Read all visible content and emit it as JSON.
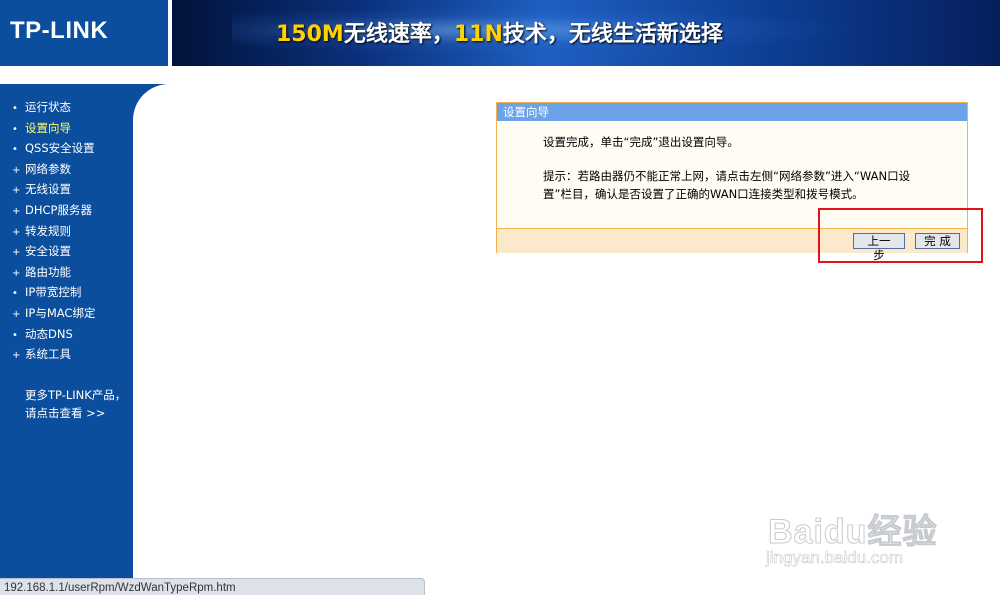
{
  "header": {
    "logo": "TP-LINK",
    "banner_hi1": "150M",
    "banner_mid1": "无线速率，",
    "banner_hi2": "11N",
    "banner_mid2": "技术，无线生活新选择"
  },
  "sidebar": {
    "items": [
      {
        "marker": "•",
        "label": "运行状态"
      },
      {
        "marker": "•",
        "label": "设置向导"
      },
      {
        "marker": "•",
        "label": "QSS安全设置"
      },
      {
        "marker": "+",
        "label": "网络参数"
      },
      {
        "marker": "+",
        "label": "无线设置"
      },
      {
        "marker": "+",
        "label": "DHCP服务器"
      },
      {
        "marker": "+",
        "label": "转发规则"
      },
      {
        "marker": "+",
        "label": "安全设置"
      },
      {
        "marker": "+",
        "label": "路由功能"
      },
      {
        "marker": "•",
        "label": "IP带宽控制"
      },
      {
        "marker": "+",
        "label": "IP与MAC绑定"
      },
      {
        "marker": "•",
        "label": "动态DNS"
      },
      {
        "marker": "+",
        "label": "系统工具"
      }
    ],
    "more_line1": "更多TP-LINK产品，",
    "more_line2": "请点击查看 >>"
  },
  "wizard": {
    "title": "设置向导",
    "message": "设置完成，单击“完成”退出设置向导。",
    "tip": "提示：若路由器仍不能正常上网，请点击左侧“网络参数”进入“WAN口设置”栏目，确认是否设置了正确的WAN口连接类型和拨号模式。",
    "prev_button": "上一步",
    "done_button": "完 成"
  },
  "statusbar": {
    "url": "192.168.1.1/userRpm/WzdWanTypeRpm.htm"
  },
  "watermark": {
    "logo": "Baidu经验",
    "url": "jingyan.baidu.com"
  },
  "colors": {
    "sidebar_blue": "#0c4e9e",
    "panel_title": "#6ba2e8",
    "panel_border": "#f5b04a",
    "highlight_red": "#e0131a"
  }
}
